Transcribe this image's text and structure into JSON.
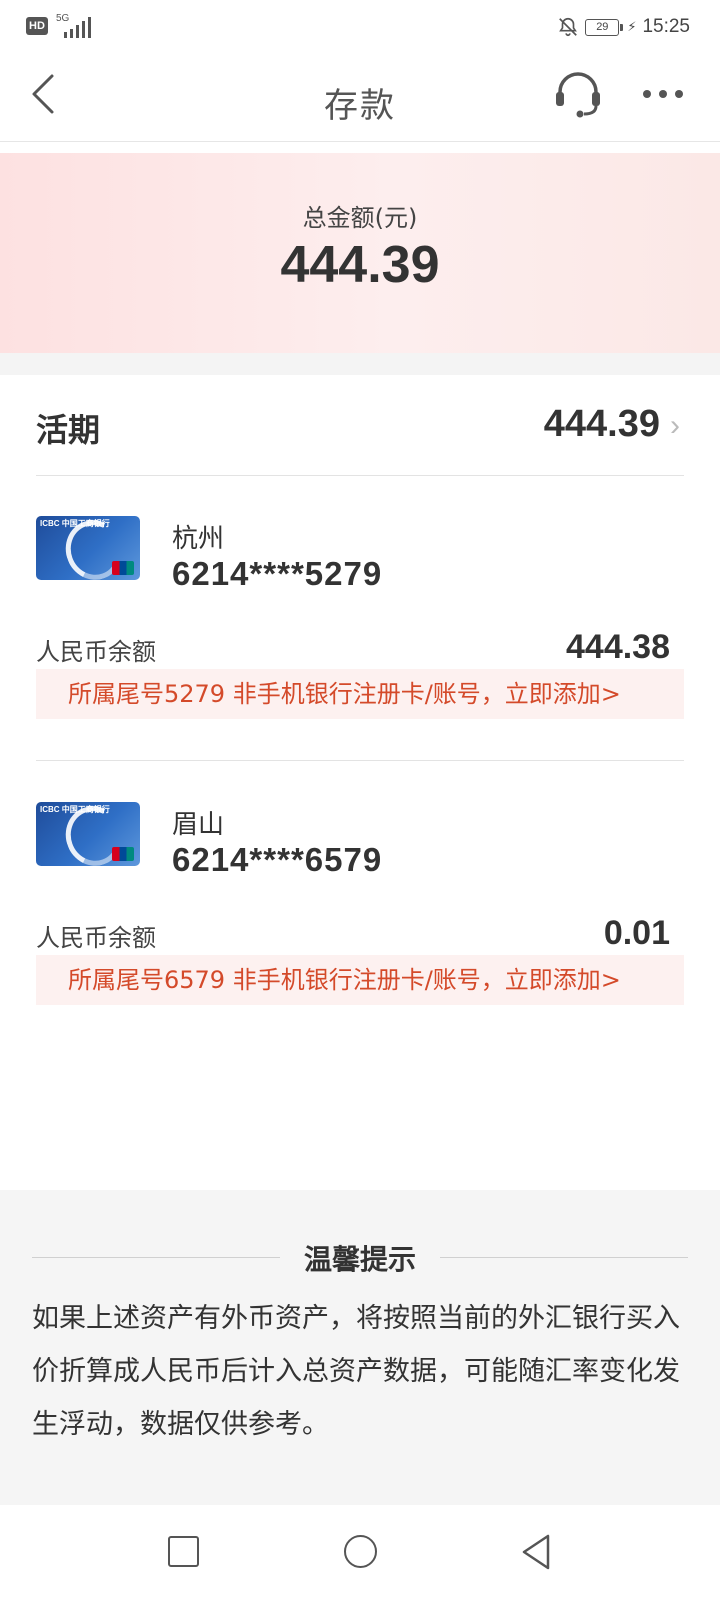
{
  "status_bar": {
    "hd": "HD",
    "network": "5G",
    "battery": "29",
    "time": "15:25",
    "icons": [
      "hd-badge",
      "signal-icon",
      "bell-off-icon",
      "battery-icon",
      "charging-icon"
    ]
  },
  "header": {
    "title": "存款",
    "icons": [
      "back-arrow-icon",
      "headset-icon",
      "more-dots-icon"
    ]
  },
  "summary": {
    "label": "总金额(元)",
    "amount": "444.39"
  },
  "current": {
    "title": "活期",
    "amount": "444.39"
  },
  "accounts": [
    {
      "city": "杭州",
      "number": "6214****5279",
      "balance_label": "人民币余额",
      "balance": "444.38",
      "add_link": "所属尾号5279 非手机银行注册卡/账号，立即添加>",
      "card_brand": "ICBC 中国工商银行"
    },
    {
      "city": "眉山",
      "number": "6214****6579",
      "balance_label": "人民币余额",
      "balance": "0.01",
      "add_link": "所属尾号6579 非手机银行注册卡/账号，立即添加>",
      "card_brand": "ICBC 中国工商银行"
    }
  ],
  "tips": {
    "title": "温馨提示",
    "body": "如果上述资产有外币资产，将按照当前的外汇银行买入价折算成人民币后计入总资产数据，可能随汇率变化发生浮动，数据仅供参考。"
  },
  "colors": {
    "accent_red": "#d44a2a",
    "link_bg": "#fdf1f0",
    "summary_bg": "#fde1e1",
    "text": "#333333"
  }
}
